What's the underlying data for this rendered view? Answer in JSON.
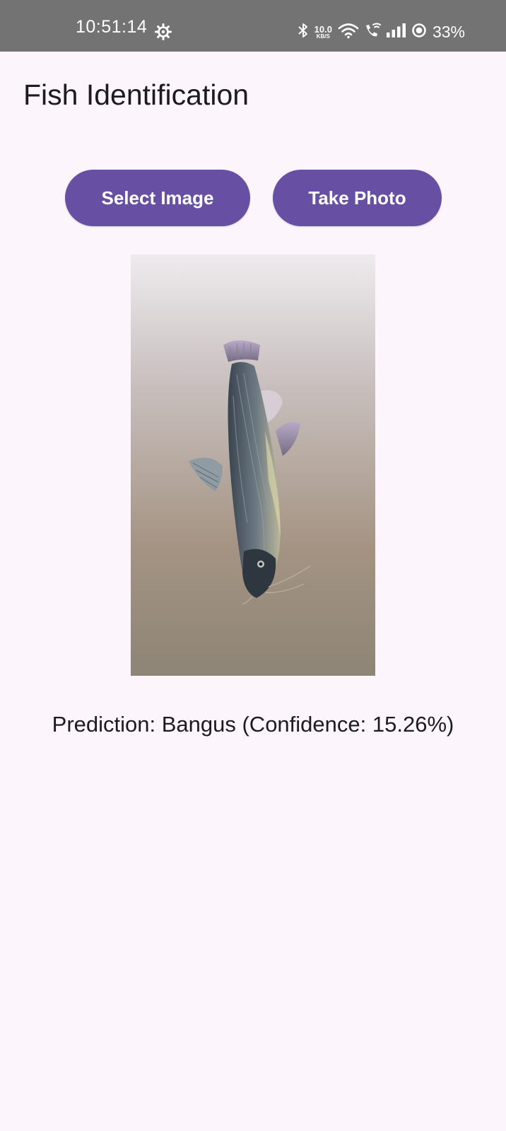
{
  "status_bar": {
    "time": "10:51:14",
    "net_speed_value": "10.0",
    "net_speed_unit": "KB/S",
    "battery_percent": "33%"
  },
  "app": {
    "title": "Fish Identification"
  },
  "buttons": {
    "select_image": "Select Image",
    "take_photo": "Take Photo"
  },
  "prediction": {
    "text": "Prediction: Bangus (Confidence: 15.26%)"
  },
  "colors": {
    "status_bar_bg": "#737373",
    "app_bg": "#FCF5FC",
    "button_bg": "#6750A4",
    "button_text": "#FFFFFF",
    "text_primary": "#1D1B20"
  },
  "icons": {
    "status_left": "settings-gear-icon",
    "status_right": [
      "bluetooth-icon",
      "wifi-icon",
      "wifi-calling-icon",
      "signal-bars-icon",
      "battery-ring-icon"
    ]
  }
}
